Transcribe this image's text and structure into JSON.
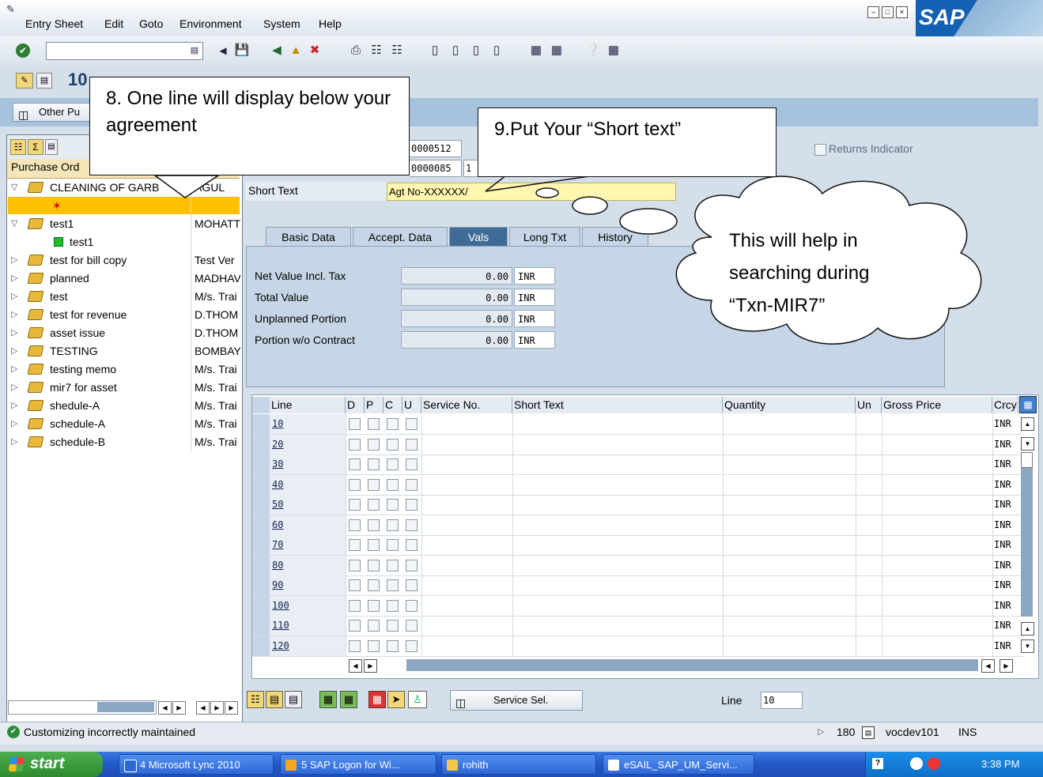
{
  "menu": {
    "items": [
      "Entry Sheet",
      "Edit",
      "Goto",
      "Environment",
      "System",
      "Help"
    ],
    "logo_text": "SAP"
  },
  "toolbar": {
    "command_value": ""
  },
  "title": {
    "text": "10"
  },
  "app_toolbar": {
    "other_button_label": "Other Pu"
  },
  "left_pane": {
    "header_label": "Purchase Ord",
    "rows": [
      {
        "label": "CLEANING OF GARB",
        "col2": "AGUL",
        "expanded": true
      },
      {
        "label": "",
        "col2": "",
        "icon": "error-icon"
      },
      {
        "label": "test1",
        "col2": "MOHATT",
        "expanded": true
      },
      {
        "label": "test1",
        "col2": "",
        "icon": "status-green-icon"
      },
      {
        "label": "test for bill copy",
        "col2": "Test Ver"
      },
      {
        "label": "planned",
        "col2": "MADHAV"
      },
      {
        "label": "test",
        "col2": "M/s. Trai"
      },
      {
        "label": "test for revenue",
        "col2": "D.THOM"
      },
      {
        "label": "asset issue",
        "col2": "D.THOM"
      },
      {
        "label": "TESTING",
        "col2": "BOMBAY"
      },
      {
        "label": "testing memo",
        "col2": "M/s. Trai"
      },
      {
        "label": "mir7 for asset",
        "col2": "M/s. Trai"
      },
      {
        "label": "shedule-A",
        "col2": "M/s. Trai"
      },
      {
        "label": "schedule-A",
        "col2": "M/s. Trai"
      },
      {
        "label": "schedule-B",
        "col2": "M/s. Trai"
      }
    ]
  },
  "header_fields": {
    "field1_value": "0000512",
    "field2_value": "0000085",
    "field2_suffix": "1",
    "returns_label": "Returns Indicator",
    "short_text_label": "Short Text",
    "short_text_value": "Agt No-XXXXXX/"
  },
  "tabs": [
    {
      "label": "Basic Data",
      "active": false
    },
    {
      "label": "Accept. Data",
      "active": false
    },
    {
      "label": "Vals",
      "active": true
    },
    {
      "label": "Long Txt",
      "active": false
    },
    {
      "label": "History",
      "active": false
    }
  ],
  "values": [
    {
      "label": "Net Value Incl. Tax",
      "amount": "0.00",
      "currency": "INR"
    },
    {
      "label": "Total Value",
      "amount": "0.00",
      "currency": "INR"
    },
    {
      "label": "Unplanned Portion",
      "amount": "0.00",
      "currency": "INR"
    },
    {
      "label": "Portion w/o Contract",
      "amount": "0.00",
      "currency": "INR"
    }
  ],
  "grid": {
    "headers": [
      "Line",
      "D",
      "P",
      "C",
      "U",
      "Service No.",
      "Short Text",
      "Quantity",
      "Un",
      "Gross Price",
      "Crcy"
    ],
    "rows": [
      "10",
      "20",
      "30",
      "40",
      "50",
      "60",
      "70",
      "80",
      "90",
      "100",
      "110",
      "120"
    ],
    "currency": "INR"
  },
  "bottom": {
    "service_sel_label": "Service Sel.",
    "line_label": "Line",
    "line_value": "10"
  },
  "status": {
    "message": "Customizing incorrectly maintained",
    "session": "180",
    "server": "vocdev101",
    "mode": "INS"
  },
  "callouts": {
    "c8": "8. One line will display below your agreement",
    "c9": "9.Put Your “Short text”",
    "cloud": "This will help in searching during “Txn-MIR7”"
  },
  "taskbar": {
    "start_label": "start",
    "tasks": [
      "4 Microsoft Lync 2010",
      "5 SAP Logon for Wi...",
      "rohith",
      "eSAIL_SAP_UM_Servi..."
    ],
    "clock": "3:38 PM"
  },
  "colors": {
    "sap_blue": "#1461b4",
    "app_toolbar": "#a7c2dc",
    "active_tab": "#3f6c97",
    "short_text_bg": "#fff6b0",
    "selected_row": "#ffc000",
    "taskbar": "#2357c8"
  }
}
